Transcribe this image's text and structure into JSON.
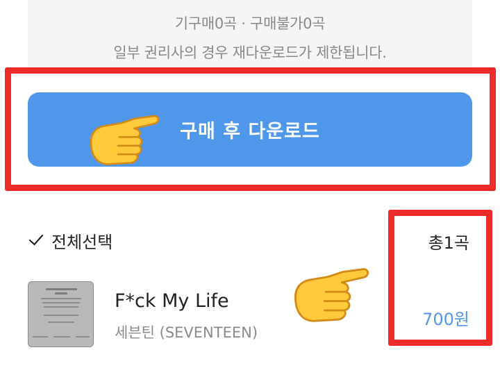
{
  "info": {
    "counts_line": "기구매0곡 · 구매불가0곡",
    "notice": "일부 권리사의 경우 재다운로드가 제한됩니다."
  },
  "buy_button": {
    "label": "구매 후 다운로드"
  },
  "list_header": {
    "select_all_label": "전체선택",
    "total_count": "총1곡"
  },
  "tracks": [
    {
      "title": "F*ck My Life",
      "artist": "세븐틴 (SEVENTEEN)",
      "price": "700원"
    }
  ],
  "colors": {
    "accent": "#4f97ea",
    "highlight_frame": "#ee2b2b",
    "info_bg": "#f5f5f5"
  },
  "icons": [
    "checkmark-icon",
    "pointing-hand-emoji"
  ]
}
